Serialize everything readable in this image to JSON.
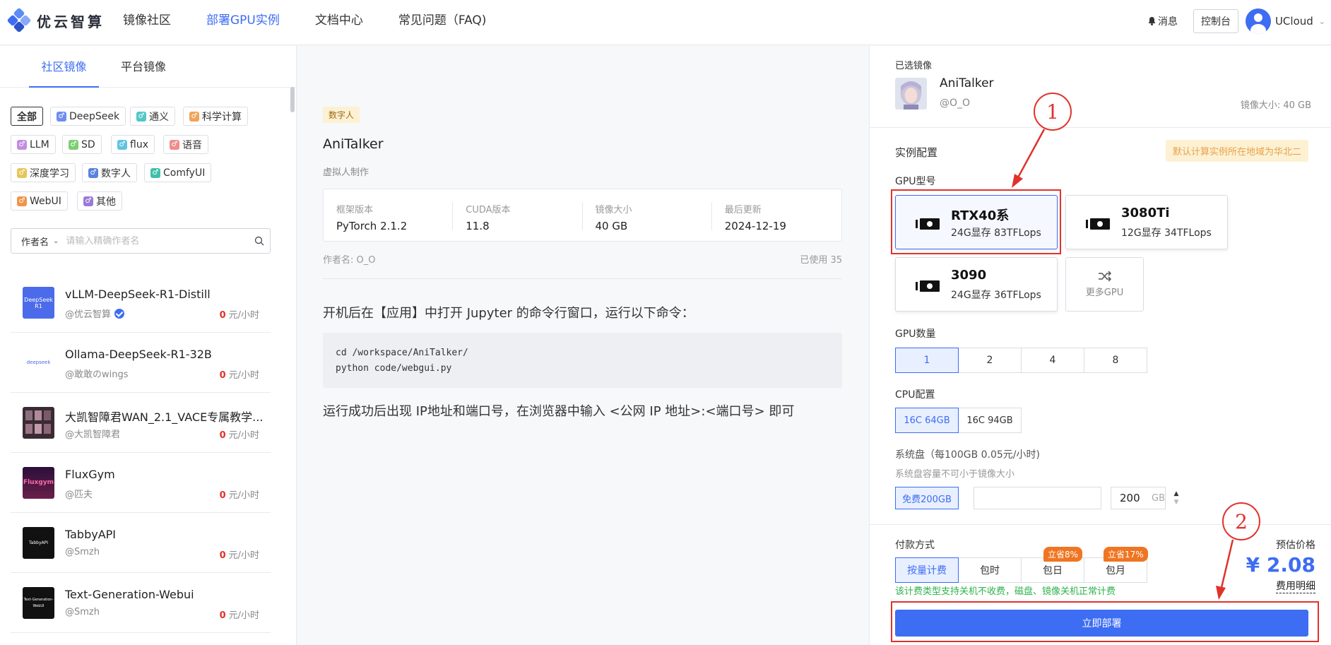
{
  "brand": {
    "name": "优云智算"
  },
  "nav": {
    "items": [
      {
        "label": "镜像社区",
        "active": false
      },
      {
        "label": "部署GPU实例",
        "active": true
      },
      {
        "label": "文档中心",
        "active": false
      },
      {
        "label": "常见问题（FAQ)",
        "active": false
      }
    ],
    "messages": "消息",
    "console": "控制台",
    "user": "UCloud"
  },
  "left": {
    "tabs": [
      "社区镜像",
      "平台镜像"
    ],
    "filters": [
      "全部",
      "DeepSeek",
      "通义",
      "科学计算",
      "LLM",
      "SD",
      "flux",
      "语音",
      "深度学习",
      "数字人",
      "ComfyUI",
      "WebUI",
      "其他"
    ],
    "search": {
      "field": "作者名",
      "placeholder": "请输入精确作者名"
    },
    "mirrors": [
      {
        "name": "vLLM-DeepSeek-R1-Distill",
        "author": "@优云智算",
        "verified": true,
        "price_num": "0",
        "price_unit": "元/小时",
        "thumb_text": "DeepSeek R1"
      },
      {
        "name": "Ollama-DeepSeek-R1-32B",
        "author": "@敢敢のwings",
        "verified": false,
        "price_num": "0",
        "price_unit": "元/小时",
        "thumb_text": "deepseek"
      },
      {
        "name": "大凯智障君WAN_2.1_VACE专属教学...",
        "author": "@大凯智障君",
        "verified": false,
        "price_num": "0",
        "price_unit": "元/小时",
        "thumb_text": ""
      },
      {
        "name": "FluxGym",
        "author": "@匹夫",
        "verified": false,
        "price_num": "0",
        "price_unit": "元/小时",
        "thumb_text": "Fluxgym"
      },
      {
        "name": "TabbyAPI",
        "author": "@Smzh",
        "verified": false,
        "price_num": "0",
        "price_unit": "元/小时",
        "thumb_text": "TabbyAPI"
      },
      {
        "name": "Text-Generation-Webui",
        "author": "@Smzh",
        "verified": false,
        "price_num": "0",
        "price_unit": "元/小时",
        "thumb_text": "Text-Generation-WebUI"
      }
    ]
  },
  "detail": {
    "tag": "数字人",
    "title": "AniTalker",
    "subtitle": "虚拟人制作",
    "info": [
      {
        "k": "框架版本",
        "v": "PyTorch 2.1.2"
      },
      {
        "k": "CUDA版本",
        "v": "11.8"
      },
      {
        "k": "镜像大小",
        "v": "40 GB"
      },
      {
        "k": "最后更新",
        "v": "2024-12-19"
      }
    ],
    "author": "作者名: O_O",
    "used": "已使用 35",
    "instruction1": "开机后在【应用】中打开 Jupyter 的命令行窗口，运行以下命令：",
    "code": "cd /workspace/AniTalker/\npython code/webgui.py",
    "instruction2": "运行成功后出现 IP地址和端口号，在浏览器中输入 <公网 IP 地址>:<端口号> 即可"
  },
  "config": {
    "selected_label": "已选镜像",
    "selected_name": "AniTalker",
    "selected_author": "@O_O",
    "selected_size": "镜像大小: 40 GB",
    "instance_label": "实例配置",
    "region_note": "默认计算实例所在地域为华北二",
    "gpu_label": "GPU型号",
    "gpus": [
      {
        "name": "RTX40系",
        "spec": "24G显存 83TFLops",
        "selected": true
      },
      {
        "name": "3080Ti",
        "spec": "12G显存 34TFLops",
        "selected": false
      },
      {
        "name": "3090",
        "spec": "24G显存 36TFLops",
        "selected": false
      }
    ],
    "more_gpu": "更多GPU",
    "gpu_count_label": "GPU数量",
    "gpu_counts": [
      "1",
      "2",
      "4",
      "8"
    ],
    "cpu_label": "CPU配置",
    "cpus": [
      "16C 64GB",
      "16C 94GB"
    ],
    "disk_label": "系统盘（每100GB 0.05元/小时)",
    "disk_hint": "系统盘容量不可小于镜像大小",
    "disk_free": "免费200GB",
    "disk_value": "200",
    "disk_unit": "GB",
    "pay_label": "付款方式",
    "pay_options": [
      "按量计费",
      "包时",
      "包日",
      "包月"
    ],
    "discounts": [
      "立省8%",
      "立省17%"
    ],
    "pay_note": "该计费类型支持关机不收费，磁盘、镜像关机正常计费",
    "price_label": "预估价格",
    "price": "¥ 2.08",
    "price_detail": "费用明细",
    "deploy": "立即部署"
  },
  "annotations": {
    "one": "1",
    "two": "2"
  },
  "colors": {
    "accent": "#3d6df2",
    "danger": "#e0322b",
    "success": "#2db34a",
    "discount": "#f07522"
  }
}
